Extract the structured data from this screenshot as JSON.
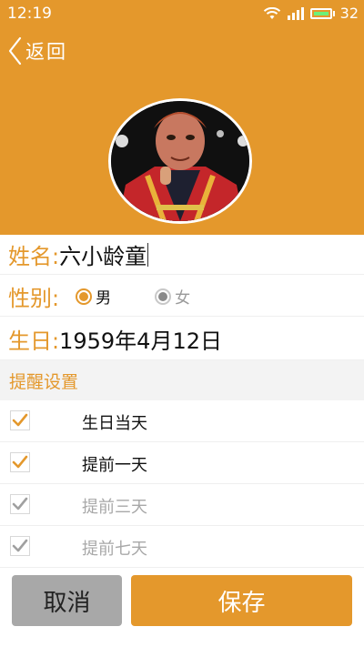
{
  "status_bar": {
    "time": "12:19",
    "battery_level": "32"
  },
  "nav": {
    "back_label": "返回"
  },
  "profile": {
    "name_label": "姓名:",
    "name_value": "六小龄童",
    "gender_label": "性别:",
    "gender_options": [
      {
        "label": "男",
        "selected": true
      },
      {
        "label": "女",
        "selected": false
      }
    ],
    "birthday_label": "生日:",
    "birthday_value": "1959年4月12日"
  },
  "reminders": {
    "title": "提醒设置",
    "items": [
      {
        "label": "生日当天",
        "checked": true,
        "enabled": true
      },
      {
        "label": "提前一天",
        "checked": true,
        "enabled": true
      },
      {
        "label": "提前三天",
        "checked": true,
        "enabled": false
      },
      {
        "label": "提前七天",
        "checked": true,
        "enabled": false
      }
    ]
  },
  "actions": {
    "cancel_label": "取消",
    "save_label": "保存"
  },
  "colors": {
    "accent": "#e4982c",
    "cancel_bg": "#a8a8a8",
    "section_bg": "#f3f3f3",
    "check_disabled": "#a0a0a0"
  },
  "icons": [
    "wifi-icon",
    "signal-icon",
    "battery-icon",
    "back-chevron-icon",
    "check-icon"
  ]
}
